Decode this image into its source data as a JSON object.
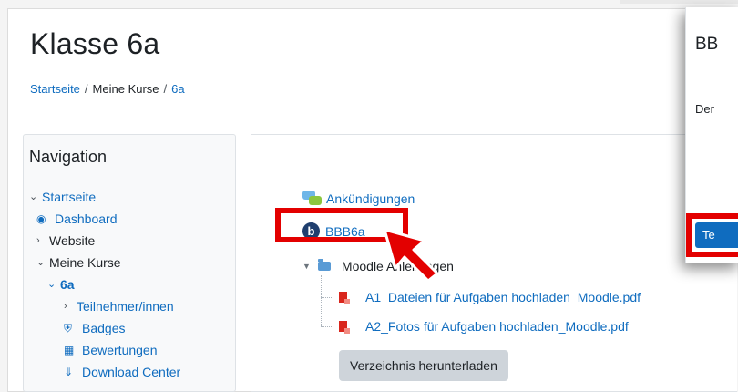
{
  "page": {
    "title": "Klasse 6a",
    "breadcrumb": [
      "Startseite",
      "Meine Kurse",
      "6a"
    ],
    "separator": "/"
  },
  "navigation": {
    "heading": "Navigation",
    "items": {
      "startseite": "Startseite",
      "dashboard": "Dashboard",
      "website": "Website",
      "meine_kurse": "Meine Kurse",
      "course": "6a",
      "teilnehmer": "Teilnehmer/innen",
      "badges": "Badges",
      "bewertungen": "Bewertungen",
      "download_center": "Download Center"
    }
  },
  "content": {
    "forum": "Ankündigungen",
    "bbb": "BBB6a",
    "folder": "Moodle Anleitungen",
    "files": [
      "A1_Dateien für Aufgaben hochladen_Moodle.pdf",
      "A2_Fotos für Aufgaben hochladen_Moodle.pdf"
    ],
    "download_button": "Verzeichnis herunterladen"
  },
  "popup": {
    "title": "BB",
    "text": "Der",
    "button": "Te"
  },
  "colors": {
    "link": "#0f6cbf",
    "highlight": "#e30000",
    "button_bg": "#ced4da"
  }
}
